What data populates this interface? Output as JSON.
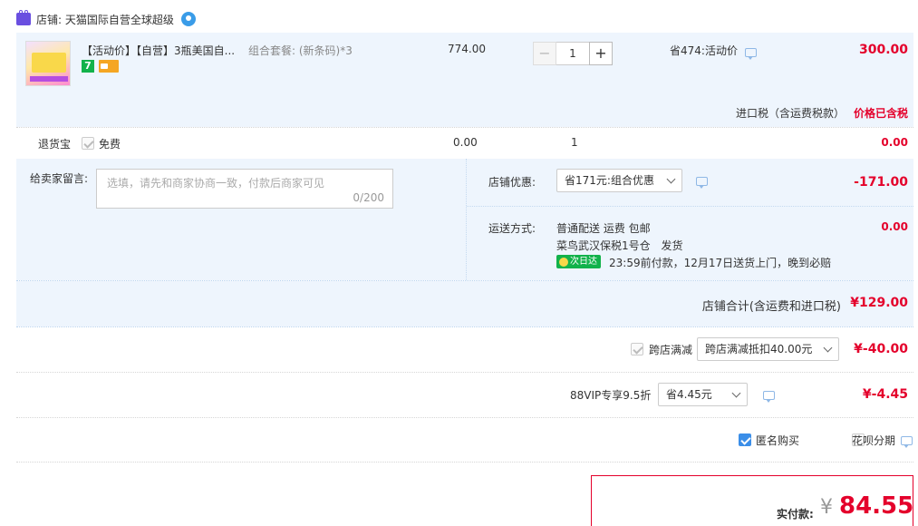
{
  "shop": {
    "label": "店铺: 天猫国际自营全球超级"
  },
  "item": {
    "title": "【活动价】【自营】3瓶美国自...",
    "package": "组合套餐: (新条码)*3",
    "unit_price": "774.00",
    "quantity": "1",
    "promo": "省474:活动价",
    "subtotal": "300.00",
    "badge_seven": "7",
    "tax_label": "进口税（含运费税款）",
    "tax_value": "价格已含税"
  },
  "return_insurance": {
    "label": "退货宝",
    "option": "免费",
    "price": "0.00",
    "qty": "1",
    "total": "0.00"
  },
  "message": {
    "label": "给卖家留言:",
    "placeholder": "选填，请先和商家协商一致，付款后商家可见",
    "counter": "0/200"
  },
  "shop_discount": {
    "label": "店铺优惠:",
    "selected": "省171元:组合优惠",
    "amount": "-171.00"
  },
  "shipping": {
    "label": "运送方式:",
    "method": "普通配送 运费 包邮",
    "warehouse": "菜鸟武汉保税1号仓",
    "ship_note": "发货",
    "next_day_badge": "次日达",
    "delivery_note": "23:59前付款，12月17日送货上门，晚到必赔",
    "amount": "0.00"
  },
  "shop_total": {
    "label": "店铺合计(含运费和进口税)",
    "amount": "¥129.00"
  },
  "cross_store": {
    "label": "跨店满减",
    "selected": "跨店满减抵扣40.00元",
    "amount": "¥-40.00"
  },
  "vip": {
    "label": "88VIP专享9.5折",
    "selected": "省4.45元",
    "amount": "¥-4.45"
  },
  "options": {
    "anonymous": "匿名购买",
    "huabei": "花呗分期"
  },
  "payment": {
    "label": "实付款:",
    "currency": "¥",
    "amount": "84.55"
  },
  "colors": {
    "accent_red": "#e4002b",
    "light_blue_bg": "#eef5fd",
    "checkbox_blue": "#3b8ee8",
    "badge_green": "#12b24b",
    "tmall_purple": "#6a4fe0"
  }
}
